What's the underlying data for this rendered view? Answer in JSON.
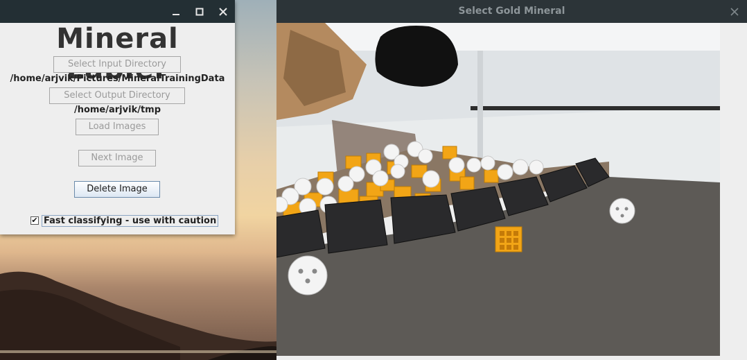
{
  "left_window": {
    "app_title": "Mineral Labler",
    "select_input_label": "Select Input Directory",
    "input_path": "/home/arjvik/Pictures/MineralTrainingData",
    "select_output_label": "Select Output Directory",
    "output_path": "/home/arjvik/tmp",
    "load_images_label": "Load Images",
    "next_image_label": "Next Image",
    "delete_image_label": "Delete Image",
    "fast_classifying_label": "Fast classifying - use with caution",
    "fast_classifying_checked": true,
    "checkmark": "✔"
  },
  "right_window": {
    "title": "Select Gold Mineral"
  },
  "icons": {
    "minimize": "minimize-icon",
    "maximize": "maximize-icon",
    "close": "close-icon"
  },
  "colors": {
    "titlebar_dark": "#232f34",
    "titlebar_right": "#2c3438",
    "window_bg": "#eeeeee",
    "gold_mineral": "#f2a516",
    "silver_mineral": "#f4f4f4",
    "floor": "#5d5a56"
  }
}
